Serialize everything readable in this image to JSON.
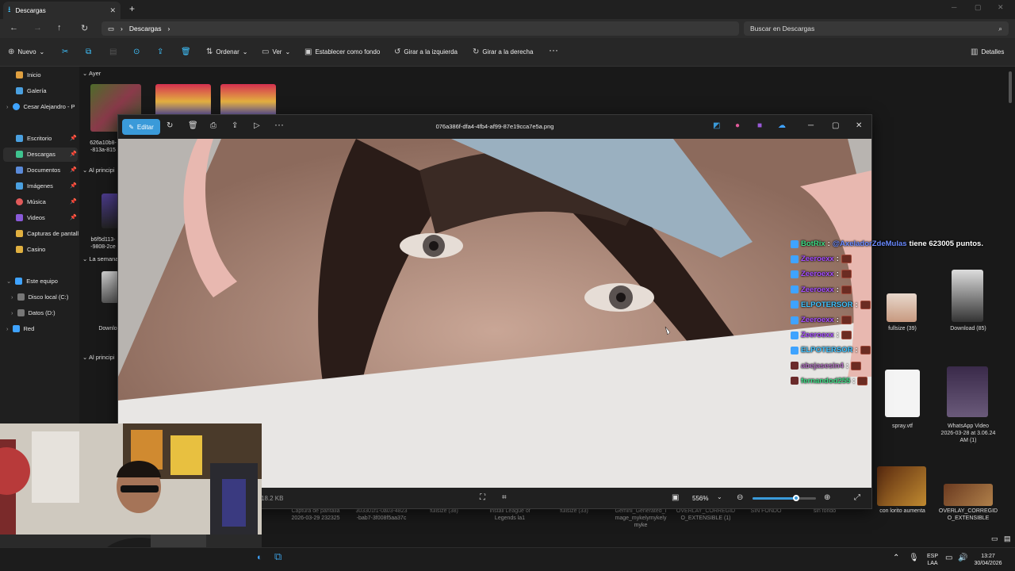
{
  "explorer": {
    "tab_title": "Descargas",
    "breadcrumb": [
      "Descargas"
    ],
    "search_placeholder": "Buscar en Descargas",
    "toolbar": {
      "new_label": "Nuevo",
      "sort_label": "Ordenar",
      "view_label": "Ver",
      "set_background_label": "Establecer como fondo",
      "rotate_left_label": "Girar a la izquierda",
      "rotate_right_label": "Girar a la derecha",
      "details_label": "Detalles"
    },
    "sidebar": {
      "items": [
        {
          "label": "Inicio"
        },
        {
          "label": "Galería"
        },
        {
          "label": "Cesar Alejandro - P"
        },
        {
          "label": "Escritorio"
        },
        {
          "label": "Descargas"
        },
        {
          "label": "Documentos"
        },
        {
          "label": "Imágenes"
        },
        {
          "label": "Música"
        },
        {
          "label": "Videos"
        },
        {
          "label": "Capturas de pantall"
        },
        {
          "label": "Casino"
        },
        {
          "label": "Este equipo"
        },
        {
          "label": "Disco local (C:)"
        },
        {
          "label": "Datos (D:)"
        },
        {
          "label": "Red"
        }
      ]
    },
    "groups": {
      "ayer": "Ayer",
      "al_principio_1": "Al principi",
      "la_semana": "La semana",
      "al_principio_2": "Al principi"
    },
    "files": {
      "left_1": "626a10b8-\n-813a-815",
      "left_2": "b6f5d113-\n-9808-2ce",
      "left_3": "Downlo",
      "right_fullsize": "fullsize (39)",
      "right_download": "Download (85)",
      "right_spray": "spray.vtf",
      "right_whatsapp": "WhatsApp Video\n2026-03-28 at 3.06.24\nAM (1)",
      "right_lorito": "con lorito aumenta",
      "right_overlay": "OVERLAY_CORREGID\nO_EXTENSIBLE",
      "bottom_row": [
        "Captura de pantalla\n2026-03-29 232325",
        "303301f1-0a03-4823\n-bab7-3f008f5aa37c",
        "fullsize (38)",
        "Install League of\nLegends la1",
        "fullsize (33)",
        "Gemini_Generated_I\nmage_mykelymykely\nmyke",
        "OVERLAY_CORREGID\nO_EXTENSIBLE (1)",
        "SIN FONDO",
        "sin fondo"
      ]
    }
  },
  "viewer": {
    "edit_label": "Editar",
    "filename": "076a386f-dfa4-4fb4-af99-87e19cca7e5a.png",
    "file_size": "18.2 KB",
    "zoom": "556%",
    "zoom_fraction": 0.68
  },
  "chat": [
    {
      "user": "BotRix",
      "user_color": "#3ddc84",
      "message": "@AxeladorZdeMulas tiene 623005 puntos.",
      "mention": "@AxeladorZdeMulas",
      "rest": " tiene 623005 puntos."
    },
    {
      "user": "Zeeroexx",
      "user_color": "#a64dff",
      "message": ":"
    },
    {
      "user": "Zeeroexx",
      "user_color": "#a64dff",
      "message": ":"
    },
    {
      "user": "Zeeroexx",
      "user_color": "#a64dff",
      "message": ":"
    },
    {
      "user": "ELPOTERSOR",
      "user_color": "#3fc3ff",
      "message": ":"
    },
    {
      "user": "Zeeroexx",
      "user_color": "#a64dff",
      "message": ":"
    },
    {
      "user": "Zeeroexx",
      "user_color": "#a64dff",
      "message": ":"
    },
    {
      "user": "ELPOTERSOR",
      "user_color": "#3fc3ff",
      "message": ":"
    },
    {
      "user": "abejasesin4",
      "user_color": "#b070c0",
      "message": ":"
    },
    {
      "user": "fernandod255",
      "user_color": "#3ddc84",
      "message": ":"
    }
  ],
  "taskbar": {
    "lang_top": "ESP",
    "lang_bottom": "LAA",
    "time": "13:27",
    "date": "30/04/2026"
  }
}
